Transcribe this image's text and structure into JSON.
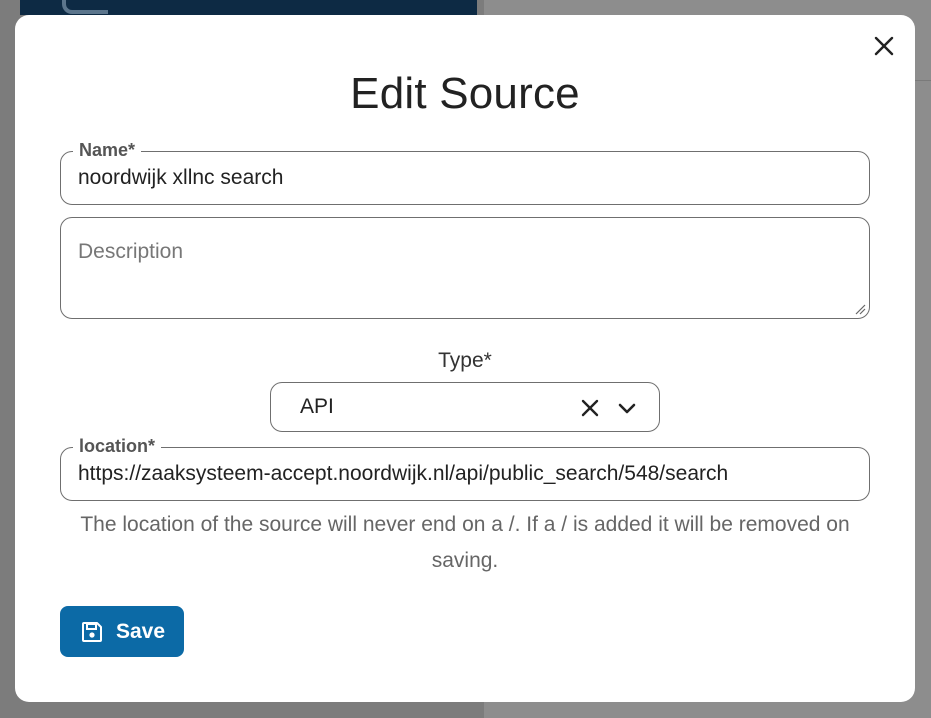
{
  "modal": {
    "title": "Edit Source",
    "close_icon": "close-icon"
  },
  "form": {
    "name": {
      "label": "Name*",
      "value": "noordwijk xllnc search"
    },
    "description": {
      "placeholder": "Description",
      "value": ""
    },
    "type": {
      "label": "Type*",
      "selected": "API",
      "clear_icon": "clear-icon",
      "dropdown_icon": "chevron-down-icon"
    },
    "location": {
      "label": "location*",
      "value": "https://zaaksysteem-accept.noordwijk.nl/api/public_search/548/search",
      "help_text": "The location of the source will never end on a /. If a / is added it will be removed on saving."
    },
    "save_button": {
      "label": "Save",
      "icon": "floppy-disk-icon"
    }
  },
  "colors": {
    "primary": "#0c6aa6",
    "backdrop": "#8a8a8a",
    "header_dark": "#0d2a44"
  }
}
